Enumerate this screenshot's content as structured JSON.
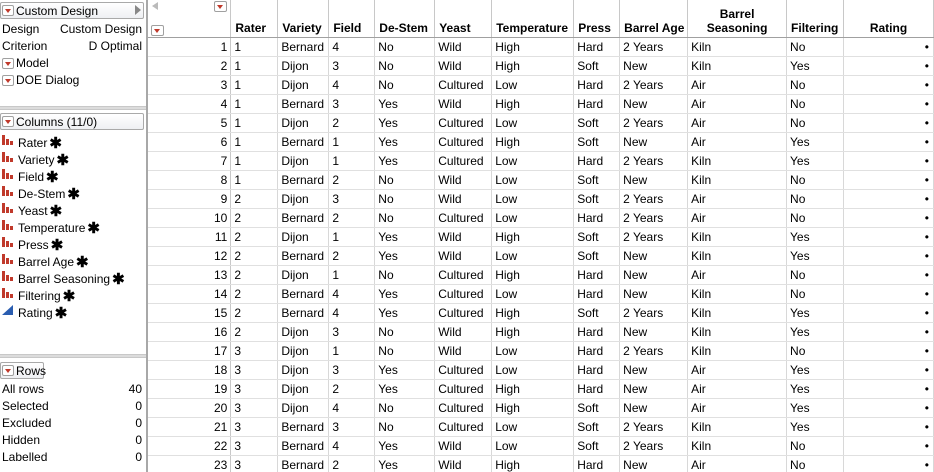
{
  "design_panel": {
    "title": "Custom Design",
    "rows": [
      {
        "key": "Design",
        "value": "Custom Design"
      },
      {
        "key": "Criterion",
        "value": "D Optimal"
      }
    ],
    "scripts": [
      "Model",
      "DOE Dialog"
    ]
  },
  "columns_panel": {
    "title": "Columns (11/0)",
    "items": [
      {
        "name": "Rater",
        "icon": "nominal-bars-icon"
      },
      {
        "name": "Variety",
        "icon": "nominal-bars-icon"
      },
      {
        "name": "Field",
        "icon": "nominal-bars-icon"
      },
      {
        "name": "De-Stem",
        "icon": "nominal-bars-icon"
      },
      {
        "name": "Yeast",
        "icon": "nominal-bars-icon"
      },
      {
        "name": "Temperature",
        "icon": "nominal-bars-icon"
      },
      {
        "name": "Press",
        "icon": "nominal-bars-icon"
      },
      {
        "name": "Barrel Age",
        "icon": "nominal-bars-icon"
      },
      {
        "name": "Barrel Seasoning",
        "icon": "nominal-bars-icon"
      },
      {
        "name": "Filtering",
        "icon": "nominal-bars-icon"
      },
      {
        "name": "Rating",
        "icon": "continuous-triangle-icon"
      }
    ],
    "role_marker": "✱"
  },
  "rows_panel": {
    "title": "Rows",
    "stats": [
      {
        "label": "All rows",
        "value": "40"
      },
      {
        "label": "Selected",
        "value": "0"
      },
      {
        "label": "Excluded",
        "value": "0"
      },
      {
        "label": "Hidden",
        "value": "0"
      },
      {
        "label": "Labelled",
        "value": "0"
      }
    ]
  },
  "table": {
    "headers": [
      "Rater",
      "Variety",
      "Field",
      "De-Stem",
      "Yeast",
      "Temperature",
      "Press",
      "Barrel Age",
      "Barrel Seasoning",
      "Filtering",
      "Rating"
    ],
    "rows": [
      [
        "1",
        "1",
        "Bernard",
        "4",
        "No",
        "Wild",
        "High",
        "Hard",
        "2 Years",
        "Kiln",
        "No",
        "•"
      ],
      [
        "2",
        "1",
        "Dijon",
        "3",
        "No",
        "Wild",
        "High",
        "Soft",
        "New",
        "Kiln",
        "Yes",
        "•"
      ],
      [
        "3",
        "1",
        "Dijon",
        "4",
        "No",
        "Cultured",
        "Low",
        "Hard",
        "2 Years",
        "Air",
        "No",
        "•"
      ],
      [
        "4",
        "1",
        "Bernard",
        "3",
        "Yes",
        "Wild",
        "High",
        "Hard",
        "New",
        "Air",
        "No",
        "•"
      ],
      [
        "5",
        "1",
        "Dijon",
        "2",
        "Yes",
        "Cultured",
        "Low",
        "Soft",
        "2 Years",
        "Air",
        "No",
        "•"
      ],
      [
        "6",
        "1",
        "Bernard",
        "1",
        "Yes",
        "Cultured",
        "High",
        "Soft",
        "New",
        "Air",
        "Yes",
        "•"
      ],
      [
        "7",
        "1",
        "Dijon",
        "1",
        "Yes",
        "Cultured",
        "Low",
        "Hard",
        "2 Years",
        "Kiln",
        "Yes",
        "•"
      ],
      [
        "8",
        "1",
        "Bernard",
        "2",
        "No",
        "Wild",
        "Low",
        "Soft",
        "New",
        "Kiln",
        "No",
        "•"
      ],
      [
        "9",
        "2",
        "Dijon",
        "3",
        "No",
        "Wild",
        "Low",
        "Soft",
        "2 Years",
        "Air",
        "No",
        "•"
      ],
      [
        "10",
        "2",
        "Bernard",
        "2",
        "No",
        "Cultured",
        "Low",
        "Hard",
        "2 Years",
        "Air",
        "No",
        "•"
      ],
      [
        "11",
        "2",
        "Dijon",
        "1",
        "Yes",
        "Wild",
        "High",
        "Soft",
        "2 Years",
        "Kiln",
        "Yes",
        "•"
      ],
      [
        "12",
        "2",
        "Bernard",
        "2",
        "Yes",
        "Wild",
        "Low",
        "Soft",
        "New",
        "Kiln",
        "Yes",
        "•"
      ],
      [
        "13",
        "2",
        "Dijon",
        "1",
        "No",
        "Cultured",
        "High",
        "Hard",
        "New",
        "Air",
        "No",
        "•"
      ],
      [
        "14",
        "2",
        "Bernard",
        "4",
        "Yes",
        "Cultured",
        "Low",
        "Hard",
        "New",
        "Kiln",
        "No",
        "•"
      ],
      [
        "15",
        "2",
        "Bernard",
        "4",
        "Yes",
        "Cultured",
        "High",
        "Soft",
        "2 Years",
        "Kiln",
        "Yes",
        "•"
      ],
      [
        "16",
        "2",
        "Dijon",
        "3",
        "No",
        "Wild",
        "High",
        "Hard",
        "New",
        "Kiln",
        "Yes",
        "•"
      ],
      [
        "17",
        "3",
        "Dijon",
        "1",
        "No",
        "Wild",
        "Low",
        "Hard",
        "2 Years",
        "Kiln",
        "No",
        "•"
      ],
      [
        "18",
        "3",
        "Dijon",
        "3",
        "Yes",
        "Cultured",
        "Low",
        "Hard",
        "New",
        "Air",
        "Yes",
        "•"
      ],
      [
        "19",
        "3",
        "Dijon",
        "2",
        "Yes",
        "Cultured",
        "High",
        "Hard",
        "New",
        "Air",
        "Yes",
        "•"
      ],
      [
        "20",
        "3",
        "Dijon",
        "4",
        "No",
        "Cultured",
        "High",
        "Soft",
        "New",
        "Air",
        "Yes",
        "•"
      ],
      [
        "21",
        "3",
        "Bernard",
        "3",
        "No",
        "Cultured",
        "Low",
        "Soft",
        "2 Years",
        "Kiln",
        "Yes",
        "•"
      ],
      [
        "22",
        "3",
        "Bernard",
        "4",
        "Yes",
        "Wild",
        "Low",
        "Soft",
        "2 Years",
        "Kiln",
        "No",
        "•"
      ],
      [
        "23",
        "3",
        "Bernard",
        "2",
        "Yes",
        "Wild",
        "High",
        "Hard",
        "New",
        "Air",
        "No",
        "•"
      ]
    ]
  },
  "colors": {
    "accent_red": "#c0392b",
    "continuous_blue": "#2a5db0"
  }
}
